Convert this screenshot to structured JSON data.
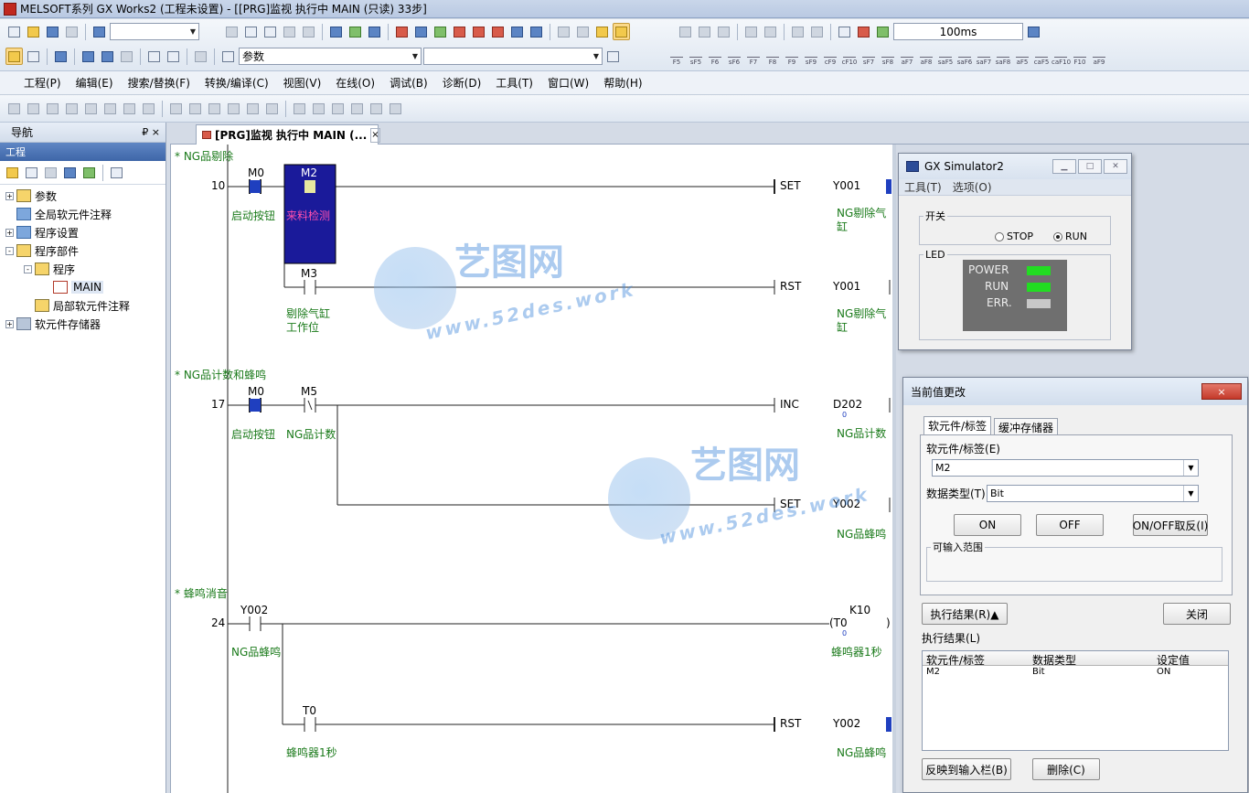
{
  "window": {
    "title": "MELSOFT系列 GX Works2 (工程未设置) - [[PRG]监视 执行中 MAIN (只读) 33步]"
  },
  "toolbar": {
    "scan_time": "100ms",
    "search_combo": "参数",
    "fkeys": [
      "F5",
      "sF5",
      "F6",
      "sF6",
      "F7",
      "F8",
      "F9",
      "sF9",
      "cF9",
      "cF10",
      "sF7",
      "sF8",
      "aF7",
      "aF8",
      "saF5",
      "saF6",
      "saF7",
      "saF8",
      "aF5",
      "caF5",
      "caF10",
      "F10",
      "aF9"
    ]
  },
  "menu": [
    "工程(P)",
    "编辑(E)",
    "搜索/替换(F)",
    "转换/编译(C)",
    "视图(V)",
    "在线(O)",
    "调试(B)",
    "诊断(D)",
    "工具(T)",
    "窗口(W)",
    "帮助(H)"
  ],
  "nav": {
    "title": "导航",
    "pin": "₽ ×",
    "section": "工程",
    "tree": [
      {
        "label": "参数",
        "level": 0,
        "exp": "+"
      },
      {
        "label": "全局软元件注释",
        "level": 0,
        "exp": ""
      },
      {
        "label": "程序设置",
        "level": 0,
        "exp": "+"
      },
      {
        "label": "程序部件",
        "level": 0,
        "exp": "-"
      },
      {
        "label": "程序",
        "level": 1,
        "exp": "-"
      },
      {
        "label": "MAIN",
        "level": 2,
        "exp": ""
      },
      {
        "label": "局部软元件注释",
        "level": 1,
        "exp": ""
      },
      {
        "label": "软元件存储器",
        "level": 0,
        "exp": "+"
      }
    ]
  },
  "tab": {
    "label": "[PRG]监视 执行中 MAIN (...",
    "close": "×"
  },
  "ladder": {
    "r1_comment": "* NG品剔除",
    "r1_step": "10",
    "r1_m0": "M0",
    "r1_m0_c": "启动按钮",
    "r1_m2": "M2",
    "r1_m2_c": "来料检测",
    "r1_set": "SET",
    "r1_y001": "Y001",
    "r1_y001_c": "NG剔除气缸",
    "r1_m3": "M3",
    "r1_m3_c": "剔除气缸工作位",
    "r1_rst": "RST",
    "r1_y001b": "Y001",
    "r1_y001b_c": "NG剔除气缸",
    "r2_comment": "* NG品计数和蜂鸣",
    "r2_step": "17",
    "r2_m0": "M0",
    "r2_m0_c": "启动按钮",
    "r2_m5": "M5",
    "r2_m5_c": "NG品计数",
    "r2_inc": "INC",
    "r2_d202": "D202",
    "r2_d202_v": "0",
    "r2_d202_c": "NG品计数",
    "r2_set": "SET",
    "r2_y002": "Y002",
    "r2_y002_c": "NG品蜂鸣",
    "r3_comment": "* 蜂鸣消音",
    "r3_step": "24",
    "r3_y002": "Y002",
    "r3_y002_c": "NG品蜂鸣",
    "r3_k10": "K10",
    "r3_t0": "(T0",
    "r3_t0_v": "0",
    "r3_t0_c": "蜂鸣器1秒",
    "r3_t0b": "T0",
    "r3_t0b_c": "蜂鸣器1秒",
    "r3_rst": "RST",
    "r3_y002b": "Y002",
    "r3_y002b_c": "NG品蜂鸣"
  },
  "watermark": {
    "cn": "艺图网",
    "url": "www.52des.work"
  },
  "simulator": {
    "title": "GX Simulator2",
    "menu": [
      "工具(T)",
      "选项(O)"
    ],
    "switch_label": "开关",
    "stop": "STOP",
    "run": "RUN",
    "led_label": "LED",
    "leds": [
      {
        "name": "POWER",
        "color": "#22dd22"
      },
      {
        "name": "RUN",
        "color": "#22dd22"
      },
      {
        "name": "ERR.",
        "color": "#c8c8c8"
      }
    ]
  },
  "dialog": {
    "title": "当前值更改",
    "close": "×",
    "tab1": "软元件/标签",
    "tab2": "缓冲存储器",
    "device_label": "软元件/标签(E)",
    "device_value": "M2",
    "dtype_label": "数据类型(T)",
    "dtype_value": "Bit",
    "btn_on": "ON",
    "btn_off": "OFF",
    "btn_toggle": "ON/OFF取反(I)",
    "range_label": "可输入范围",
    "result_btn": "执行结果(R)▲",
    "close_btn": "关闭",
    "result_label": "执行结果(L)",
    "cols": [
      "软元件/标签",
      "数据类型",
      "设定值"
    ],
    "rows": [
      [
        "M2",
        "Bit",
        "ON"
      ]
    ],
    "reflect_btn": "反映到输入栏(B)",
    "delete_btn": "删除(C)"
  }
}
